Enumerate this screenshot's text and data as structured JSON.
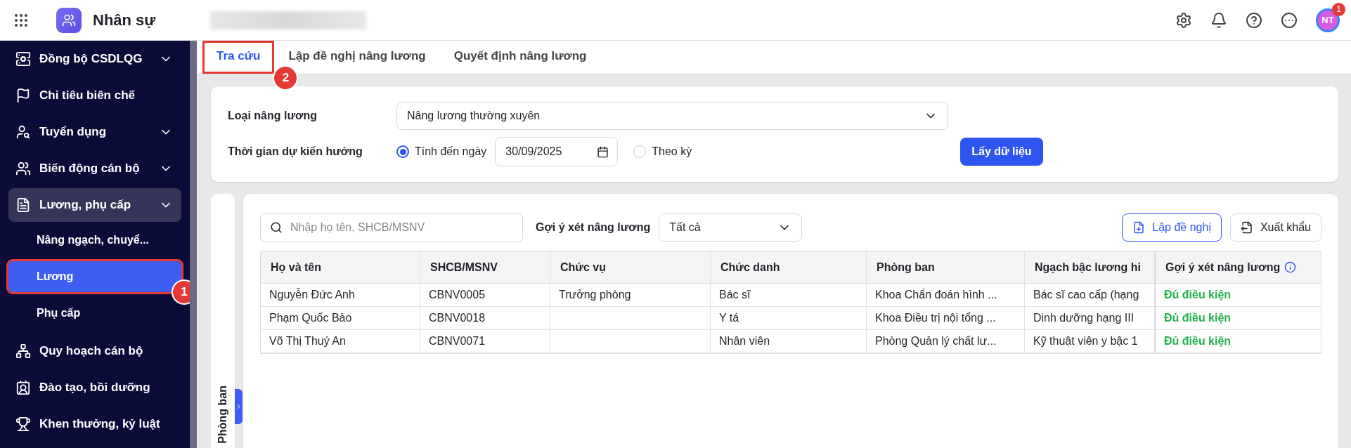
{
  "header": {
    "app_title": "Nhân sự",
    "avatar": {
      "initials": "NT",
      "badge": "1"
    }
  },
  "sidebar": {
    "items": [
      {
        "label": "Đồng bộ CSDLQG",
        "kind": "group",
        "active": false
      },
      {
        "label": "Chỉ tiêu biên chế",
        "kind": "link",
        "active": false
      },
      {
        "label": "Tuyển dụng",
        "kind": "group",
        "active": false
      },
      {
        "label": "Biến động cán bộ",
        "kind": "group",
        "active": false
      },
      {
        "label": "Lương, phụ cấp",
        "kind": "group",
        "active": true,
        "children": [
          {
            "label": "Nâng ngạch, chuyể...",
            "selected": false
          },
          {
            "label": "Lương",
            "selected": true,
            "callout": "1"
          },
          {
            "label": "Phụ cấp",
            "selected": false
          }
        ]
      },
      {
        "label": "Quy hoạch cán bộ",
        "kind": "link",
        "active": false
      },
      {
        "label": "Đào tạo, bồi dưỡng",
        "kind": "link",
        "active": false
      },
      {
        "label": "Khen thưởng, kỷ luật",
        "kind": "link",
        "active": false
      }
    ]
  },
  "tabs": [
    {
      "label": "Tra cứu",
      "selected": true,
      "callout": "2"
    },
    {
      "label": "Lập đề nghị nâng lương",
      "selected": false
    },
    {
      "label": "Quyết định nâng lương",
      "selected": false
    }
  ],
  "filter": {
    "salary_type": {
      "label": "Loại nâng lương",
      "value": "Nâng lương thường xuyên"
    },
    "expected_time": {
      "label": "Thời gian dự kiến hưởng",
      "options": [
        {
          "label": "Tính đến ngày",
          "selected": true,
          "date": "30/09/2025"
        },
        {
          "label": "Theo kỳ",
          "selected": false
        }
      ]
    },
    "fetch_button": "Lấy dữ liệu"
  },
  "side_panel": {
    "label": "Phòng ban"
  },
  "toolbar": {
    "search_placeholder": "Nhập họ tên, SHCB/MSNV",
    "suggestion_label": "Gợi ý xét nâng lương",
    "suggestion_value": "Tất cả",
    "buttons": [
      {
        "label": "Lập đề nghị",
        "kind": "create"
      },
      {
        "label": "Xuất khẩu",
        "kind": "export"
      }
    ]
  },
  "table": {
    "columns": [
      {
        "label": "Họ và tên"
      },
      {
        "label": "SHCB/MSNV"
      },
      {
        "label": "Chức vụ"
      },
      {
        "label": "Chức danh"
      },
      {
        "label": "Phòng ban"
      },
      {
        "label": "Ngạch bậc lương hi"
      },
      {
        "label": "Gợi ý xét nâng lương",
        "info": true
      }
    ],
    "rows": [
      {
        "cells": [
          "Nguyễn Đức Anh",
          "CBNV0005",
          "Trưởng phòng",
          "Bác sĩ",
          "Khoa Chẩn đoán hình ...",
          "Bác sĩ cao cấp (hạng"
        ],
        "suggestion": "Đủ điều kiện",
        "eligible": true
      },
      {
        "cells": [
          "Phạm Quốc Bảo",
          "CBNV0018",
          "",
          "Y tá",
          "Khoa Điều trị nội tổng ...",
          "Dinh dưỡng hạng III"
        ],
        "suggestion": "Đủ điều kiện",
        "eligible": true
      },
      {
        "cells": [
          "Võ Thị Thuý An",
          "CBNV0071",
          "",
          "Nhân viên",
          "Phòng Quản lý chất lư...",
          "Kỹ thuật viên y bậc 1"
        ],
        "suggestion": "Đủ điều kiện",
        "eligible": true
      }
    ]
  }
}
